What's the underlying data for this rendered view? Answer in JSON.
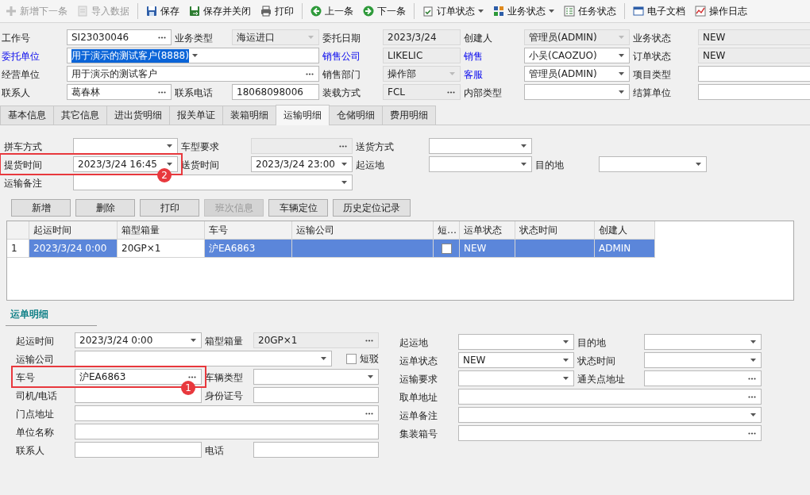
{
  "toolbar": [
    [
      {
        "label": "新增下一条",
        "disabled": true,
        "dropdown": false
      },
      {
        "label": "导入数据",
        "disabled": true,
        "dropdown": false
      }
    ],
    [
      {
        "label": "保存",
        "disabled": false,
        "dropdown": false
      },
      {
        "label": "保存并关闭",
        "disabled": false,
        "dropdown": false
      },
      {
        "label": "打印",
        "disabled": false,
        "dropdown": false
      }
    ],
    [
      {
        "label": "上一条",
        "disabled": false,
        "dropdown": false
      },
      {
        "label": "下一条",
        "disabled": false,
        "dropdown": false
      }
    ],
    [
      {
        "label": "订单状态",
        "disabled": false,
        "dropdown": true
      },
      {
        "label": "业务状态",
        "disabled": false,
        "dropdown": true
      },
      {
        "label": "任务状态",
        "disabled": false,
        "dropdown": false
      }
    ],
    [
      {
        "label": "电子文档",
        "disabled": false,
        "dropdown": false
      },
      {
        "label": "操作日志",
        "disabled": false,
        "dropdown": false
      }
    ]
  ],
  "header_form": {
    "rows": [
      [
        {
          "label": "工作号",
          "link": false,
          "kind": "lookup",
          "value": "SI23030046",
          "disabled": false,
          "highlighted": false,
          "wide": false
        },
        {
          "label": "业务类型",
          "link": false,
          "kind": "dropdown",
          "value": "海运进口",
          "disabled": true,
          "highlighted": false,
          "wide": false
        },
        {
          "label": "委托日期",
          "link": false,
          "kind": "text",
          "value": "2023/3/24",
          "disabled": true,
          "highlighted": false,
          "wide": false
        },
        {
          "label": "创建人",
          "link": false,
          "kind": "dropdown",
          "value": "管理员(ADMIN)",
          "disabled": true,
          "highlighted": false,
          "wide": false
        },
        {
          "label": "业务状态",
          "link": false,
          "kind": "text",
          "value": "NEW",
          "disabled": true,
          "highlighted": false,
          "wide": false
        }
      ],
      [
        {
          "label": "委托单位",
          "link": true,
          "kind": "dropdown",
          "value": "用于演示的测试客户(8888)",
          "disabled": false,
          "highlighted": true,
          "wide": true
        },
        {
          "label": "销售公司",
          "link": true,
          "kind": "text",
          "value": "LIKELIC",
          "disabled": true,
          "highlighted": false,
          "wide": false
        },
        {
          "label": "销售",
          "link": true,
          "kind": "dropdown",
          "value": "小吴(CAOZUO)",
          "disabled": false,
          "highlighted": false,
          "wide": false
        },
        {
          "label": "订单状态",
          "link": false,
          "kind": "text",
          "value": "NEW",
          "disabled": true,
          "highlighted": false,
          "wide": false
        }
      ],
      [
        {
          "label": "经营单位",
          "link": false,
          "kind": "lookup",
          "value": "用于演示的测试客户",
          "disabled": false,
          "highlighted": false,
          "wide": true
        },
        {
          "label": "销售部门",
          "link": false,
          "kind": "dropdown",
          "value": "操作部",
          "disabled": true,
          "highlighted": false,
          "wide": false
        },
        {
          "label": "客服",
          "link": true,
          "kind": "dropdown",
          "value": "管理员(ADMIN)",
          "disabled": false,
          "highlighted": false,
          "wide": false
        },
        {
          "label": "项目类型",
          "link": false,
          "kind": "text",
          "disabled": false,
          "wide": false
        }
      ],
      [
        {
          "label": "联系人",
          "link": false,
          "kind": "lookup",
          "value": "葛春林",
          "disabled": false,
          "highlighted": false,
          "wide": false
        },
        {
          "label": "联系电话",
          "link": false,
          "kind": "text",
          "value": "18068098006",
          "disabled": false,
          "highlighted": false,
          "wide": false
        },
        {
          "label": "装载方式",
          "link": false,
          "kind": "lookup",
          "value": "FCL",
          "disabled": true,
          "highlighted": false,
          "wide": false
        },
        {
          "label": "内部类型",
          "link": false,
          "kind": "dropdown",
          "disabled": false,
          "wide": false
        },
        {
          "label": "结算单位",
          "link": false,
          "kind": "text",
          "disabled": false,
          "wide": false
        }
      ]
    ]
  },
  "tabs": [
    {
      "label": "基本信息",
      "selected": false
    },
    {
      "label": "其它信息",
      "selected": false
    },
    {
      "label": "进出货明细",
      "selected": false
    },
    {
      "label": "报关单证",
      "selected": false
    },
    {
      "label": "装箱明细",
      "selected": false
    },
    {
      "label": "运输明细",
      "selected": true
    },
    {
      "label": "仓储明细",
      "selected": false
    },
    {
      "label": "费用明细",
      "selected": false
    }
  ],
  "transport_form": {
    "rows": [
      [
        {
          "label": "拼车方式",
          "kind": "dropdown",
          "disabled": false,
          "wide": false
        },
        {
          "label": "车型要求",
          "kind": "lookup",
          "disabled": true,
          "wide": false
        },
        {
          "label": "送货方式",
          "kind": "dropdown",
          "disabled": false,
          "wide": false
        }
      ],
      [
        {
          "label": "提货时间",
          "kind": "dropdown",
          "value": "2023/3/24 16:45",
          "disabled": false,
          "wide": false,
          "annotation": "2"
        },
        {
          "label": "送货时间",
          "kind": "dropdown",
          "value": "2023/3/24 23:00",
          "disabled": false,
          "wide": false
        },
        {
          "label": "起运地",
          "kind": "dropdown",
          "disabled": false,
          "wide": false
        },
        {
          "label": "目的地",
          "kind": "dropdown",
          "disabled": false,
          "wide": false
        }
      ],
      [
        {
          "label": "运输备注",
          "kind": "dropdown",
          "disabled": false,
          "wide": true
        }
      ]
    ]
  },
  "transport_buttons": [
    {
      "label": "新增",
      "disabled": false
    },
    {
      "label": "删除",
      "disabled": false
    },
    {
      "label": "打印",
      "disabled": false
    },
    {
      "label": "班次信息",
      "disabled": true
    },
    {
      "label": "车辆定位",
      "disabled": false
    },
    {
      "label": "历史定位记录",
      "disabled": false
    }
  ],
  "transport_table": {
    "columns": [
      "起运时间",
      "箱型箱量",
      "车号",
      "运输公司",
      "短…",
      "运单状态",
      "状态时间",
      "创建人"
    ],
    "rows": [
      {
        "number": "1",
        "selected": true,
        "cells": [
          {
            "kind": "text",
            "text": "2023/3/24 0:00",
            "focused": false
          },
          {
            "kind": "text",
            "text": "20GP×1",
            "focused": true
          },
          {
            "kind": "text",
            "text": "沪EA6863",
            "focused": false
          },
          {
            "kind": "text",
            "focused": false
          },
          {
            "kind": "checkbox",
            "checked": false,
            "focused": false
          },
          {
            "kind": "text",
            "text": "NEW",
            "focused": false
          },
          {
            "kind": "text",
            "focused": false
          },
          {
            "kind": "text",
            "text": "ADMIN",
            "focused": false
          }
        ]
      }
    ]
  },
  "waybill_detail": {
    "title": "运单明细",
    "left_rows": [
      [
        {
          "label": "起运时间",
          "kind": "dropdown",
          "value": "2023/3/24 0:00",
          "disabled": false,
          "wide": false
        },
        {
          "label": "箱型箱量",
          "kind": "lookup",
          "value": "20GP×1",
          "disabled": true,
          "wide": false
        }
      ],
      [
        {
          "label": "运输公司",
          "kind": "dropdown",
          "disabled": false,
          "wide": true,
          "checkbox": {
            "label": "短驳",
            "checked": false
          }
        }
      ],
      [
        {
          "label": "车号",
          "kind": "lookup",
          "value": "沪EA6863",
          "disabled": false,
          "wide": false,
          "annotation": "1"
        },
        {
          "label": "车辆类型",
          "kind": "dropdown",
          "disabled": false,
          "wide": false
        }
      ],
      [
        {
          "label": "司机/电话",
          "kind": "text",
          "disabled": false,
          "wide": false
        },
        {
          "label": "身份证号",
          "kind": "text",
          "disabled": false,
          "wide": false
        }
      ],
      [
        {
          "label": "门点地址",
          "kind": "lookup",
          "disabled": false,
          "wide": true
        }
      ],
      [
        {
          "label": "单位名称",
          "kind": "text",
          "disabled": false,
          "wide": true
        }
      ],
      [
        {
          "label": "联系人",
          "kind": "text",
          "disabled": false,
          "wide": false
        },
        {
          "label": "电话",
          "kind": "text",
          "disabled": false,
          "wide": false
        }
      ]
    ],
    "right_rows": [
      [
        {
          "label": "起运地",
          "kind": "dropdown",
          "disabled": false,
          "wide": false
        },
        {
          "label": "目的地",
          "kind": "dropdown",
          "disabled": false,
          "wide": false
        }
      ],
      [
        {
          "label": "运单状态",
          "kind": "dropdown",
          "value": "NEW",
          "disabled": false,
          "wide": false
        },
        {
          "label": "状态时间",
          "kind": "dropdown",
          "disabled": false,
          "wide": false
        }
      ],
      [
        {
          "label": "运输要求",
          "kind": "dropdown",
          "disabled": false,
          "wide": false
        },
        {
          "label": "通关点地址",
          "kind": "lookup",
          "disabled": false,
          "wide": false
        }
      ],
      [
        {
          "label": "取单地址",
          "kind": "lookup",
          "disabled": false,
          "wide": true
        }
      ],
      [
        {
          "label": "运单备注",
          "kind": "dropdown",
          "disabled": false,
          "wide": true
        }
      ],
      [
        {
          "label": "集装箱号",
          "kind": "lookup",
          "disabled": false,
          "wide": true
        }
      ]
    ]
  }
}
